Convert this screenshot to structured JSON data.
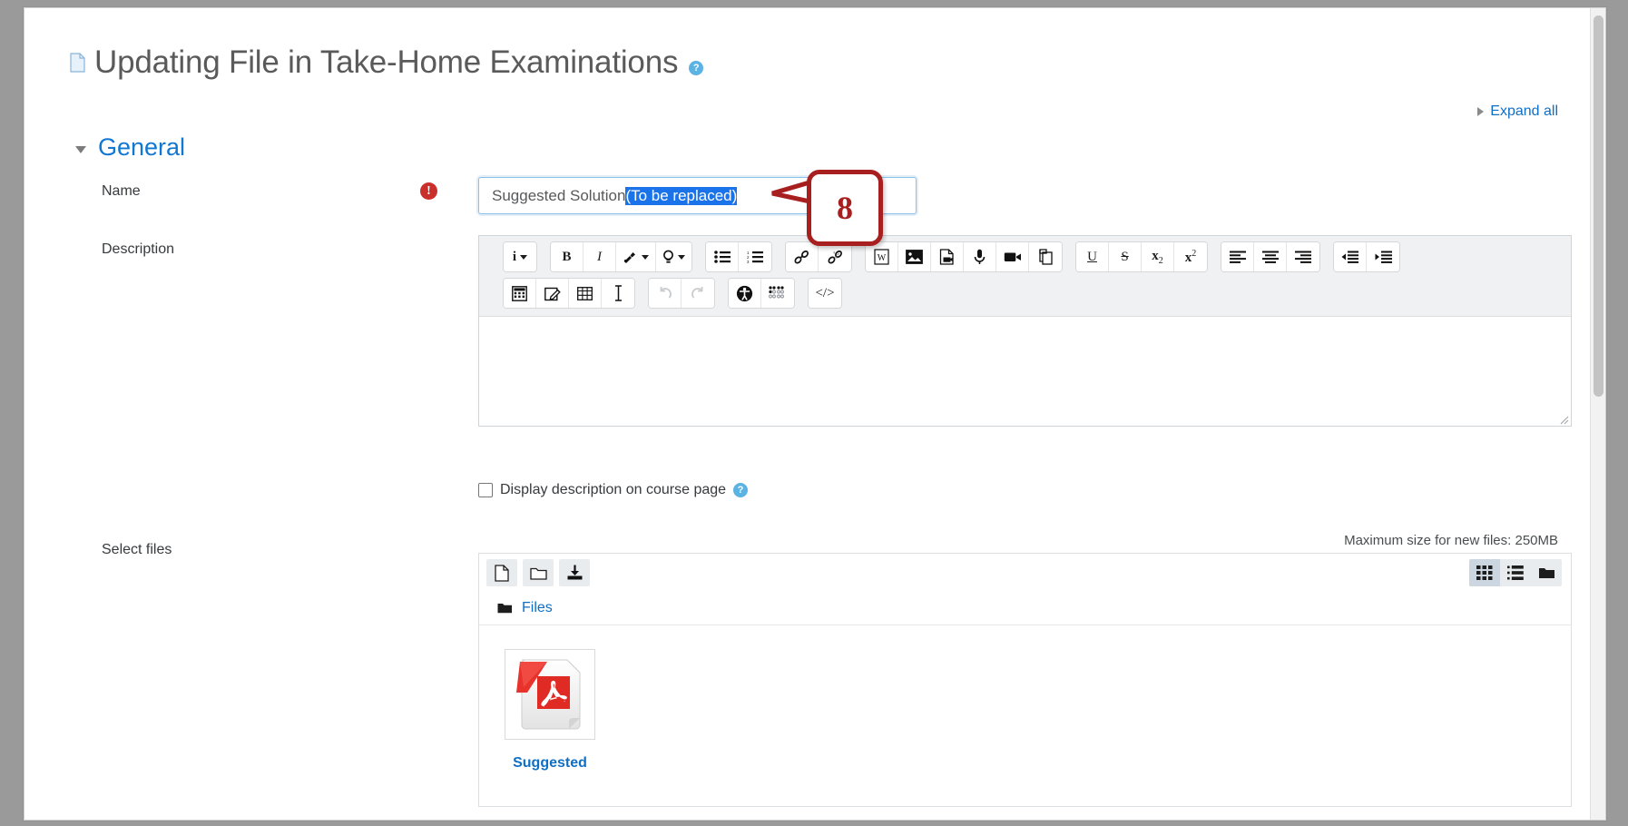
{
  "page": {
    "title": "Updating File in Take-Home Examinations",
    "title_icon": "document-icon",
    "help_icon": "?",
    "expand_all": "Expand all"
  },
  "section": {
    "title": "General"
  },
  "form": {
    "name_label": "Name",
    "required_mark": "!",
    "name_value_plain": "Suggested Solution",
    "name_value_selected": "(To be replaced)",
    "description_label": "Description",
    "select_files_label": "Select files",
    "display_description_label": "Display description on course page",
    "display_description_checked": false,
    "max_size_note": "Maximum size for new files: 250MB"
  },
  "editor": {
    "content": "",
    "toolbar_rows": [
      [
        [
          {
            "name": "style-dropdown",
            "glyph": "i",
            "caret": true
          }
        ],
        [
          {
            "name": "bold-button",
            "glyph": "B"
          },
          {
            "name": "italic-button",
            "glyph": "I"
          },
          {
            "name": "text-color-dropdown",
            "glyph": "brush",
            "caret": true
          },
          {
            "name": "highlight-dropdown",
            "glyph": "bulb",
            "caret": true
          }
        ],
        [
          {
            "name": "unordered-list-button",
            "glyph": "ul"
          },
          {
            "name": "ordered-list-button",
            "glyph": "ol"
          }
        ],
        [
          {
            "name": "insert-link-button",
            "glyph": "link"
          },
          {
            "name": "unlink-button",
            "glyph": "unlink"
          }
        ],
        [
          {
            "name": "word-import-button",
            "glyph": "word"
          },
          {
            "name": "insert-image-button",
            "glyph": "image"
          },
          {
            "name": "insert-file-button",
            "glyph": "filemedia"
          },
          {
            "name": "record-audio-button",
            "glyph": "mic"
          },
          {
            "name": "record-video-button",
            "glyph": "video"
          },
          {
            "name": "manage-files-button",
            "glyph": "copyfiles"
          }
        ],
        [
          {
            "name": "underline-button",
            "glyph": "U"
          },
          {
            "name": "strikethrough-button",
            "glyph": "S"
          },
          {
            "name": "subscript-button",
            "glyph": "x2sub"
          },
          {
            "name": "superscript-button",
            "glyph": "x2sup"
          }
        ],
        [
          {
            "name": "align-left-button",
            "glyph": "alignleft"
          },
          {
            "name": "align-center-button",
            "glyph": "aligncenter"
          },
          {
            "name": "align-right-button",
            "glyph": "alignright"
          }
        ],
        [
          {
            "name": "outdent-button",
            "glyph": "outdent"
          },
          {
            "name": "indent-button",
            "glyph": "indent"
          }
        ]
      ],
      [
        [
          {
            "name": "equation-editor-button",
            "glyph": "calculator"
          },
          {
            "name": "draw-button",
            "glyph": "pencilbox"
          },
          {
            "name": "insert-table-button",
            "glyph": "table"
          },
          {
            "name": "clear-formatting-button",
            "glyph": "ibeam"
          }
        ],
        [
          {
            "name": "undo-button",
            "glyph": "undo",
            "disabled": true
          },
          {
            "name": "redo-button",
            "glyph": "redo",
            "disabled": true
          }
        ],
        [
          {
            "name": "accessibility-checker-button",
            "glyph": "accessibility"
          },
          {
            "name": "screenreader-helper-button",
            "glyph": "braille"
          }
        ],
        [
          {
            "name": "html-source-button",
            "glyph": "code"
          }
        ]
      ]
    ]
  },
  "filemanager": {
    "add_file_icon": "file-icon",
    "create_folder_icon": "folder-icon",
    "download_all_icon": "download-icon",
    "view_grid_icon": "grid-view-icon",
    "view_list_icon": "list-view-icon",
    "view_tree_icon": "tree-view-icon",
    "active_view": "grid",
    "breadcrumb": "Files",
    "files": [
      {
        "name": "Suggested",
        "type": "pdf"
      }
    ]
  },
  "annotation": {
    "step_number": "8"
  }
}
